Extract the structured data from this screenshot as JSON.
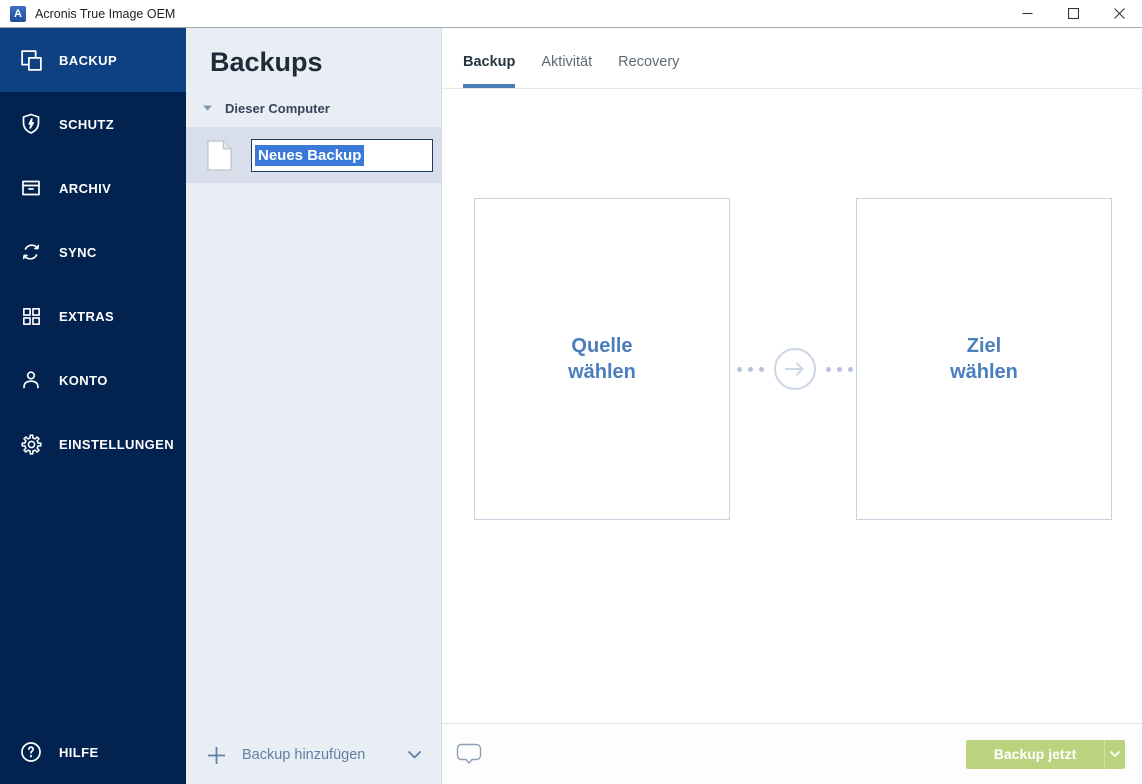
{
  "window": {
    "title": "Acronis True Image OEM"
  },
  "sidebar": {
    "items": [
      {
        "label": "BACKUP",
        "icon": "backup-copies-icon",
        "active": true
      },
      {
        "label": "SCHUTZ",
        "icon": "shield-bolt-icon",
        "active": false
      },
      {
        "label": "ARCHIV",
        "icon": "archive-box-icon",
        "active": false
      },
      {
        "label": "SYNC",
        "icon": "sync-arrows-icon",
        "active": false
      },
      {
        "label": "EXTRAS",
        "icon": "grid-squares-icon",
        "active": false
      },
      {
        "label": "KONTO",
        "icon": "person-icon",
        "active": false
      },
      {
        "label": "EINSTELLUNGEN",
        "icon": "gear-icon",
        "active": false
      }
    ],
    "help": {
      "label": "HILFE",
      "icon": "question-circle-icon"
    }
  },
  "backups_panel": {
    "title": "Backups",
    "group": {
      "label": "Dieser Computer",
      "collapsed": false
    },
    "items": [
      {
        "name": "Neues Backup",
        "selected": true,
        "editing": true,
        "icon": "file-icon"
      }
    ],
    "add_button": {
      "label": "Backup hinzufügen",
      "icons": [
        "plus-icon",
        "chevron-down-icon"
      ]
    }
  },
  "main": {
    "tabs": [
      {
        "label": "Backup",
        "active": true
      },
      {
        "label": "Aktivität",
        "active": false
      },
      {
        "label": "Recovery",
        "active": false
      }
    ],
    "source_box": {
      "line1": "Quelle",
      "line2": "wählen"
    },
    "destination_box": {
      "line1": "Ziel",
      "line2": "wählen"
    },
    "connector": {
      "icon": "arrow-right-circle-icon"
    },
    "footer": {
      "feedback_icon": "speech-bubble-icon",
      "backup_now": {
        "label": "Backup jetzt",
        "dropdown_icon": "chevron-down-icon"
      }
    }
  },
  "colors": {
    "sidebar_bg": "#02234f",
    "sidebar_active_bg": "#0d4182",
    "panel_bg": "#e9eef5",
    "row_selected_bg": "#d8dfeb",
    "selection_blue": "#3a79d8",
    "accent_blue": "#4a7ebb",
    "box_border": "#c7d2df",
    "button_green": "#b9d37f"
  }
}
